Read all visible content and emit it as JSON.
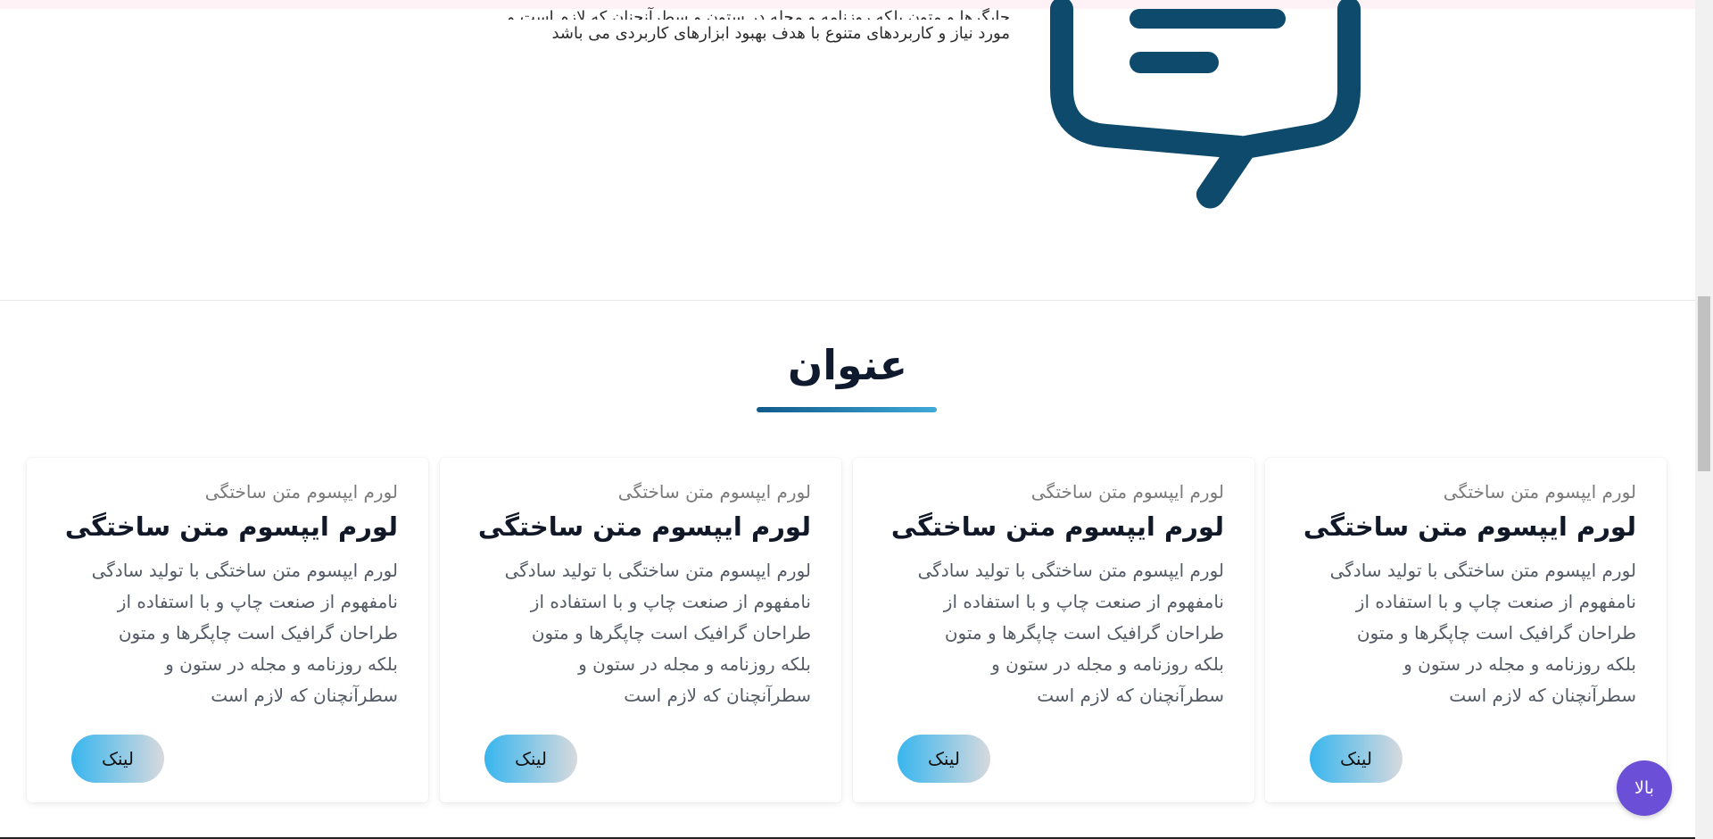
{
  "hero": {
    "text_cut": "چاپگرها و متون بلکه روزنامه و مجله در ستون و سطرآنچنان که لازم است و برای شرایط فعلی تکنولوژی",
    "text_line": "مورد نیاز و کاربردهای متنوع با هدف بهبود ابزارهای کاربردی می باشد"
  },
  "section": {
    "title": "عنوان"
  },
  "cards": [
    {
      "subtitle": "لورم ایپسوم متن ساختگی",
      "title": "لورم ایپسوم متن ساختگی",
      "body": "لورم ایپسوم متن ساختگی با تولید سادگی نامفهوم از صنعت چاپ و با استفاده از طراحان گرافیک است چاپگرها و متون بلکه روزنامه و مجله در ستون و سطرآنچنان که لازم است",
      "button_label": "لینک"
    },
    {
      "subtitle": "لورم ایپسوم متن ساختگی",
      "title": "لورم ایپسوم متن ساختگی",
      "body": "لورم ایپسوم متن ساختگی با تولید سادگی نامفهوم از صنعت چاپ و با استفاده از طراحان گرافیک است چاپگرها و متون بلکه روزنامه و مجله در ستون و سطرآنچنان که لازم است",
      "button_label": "لینک"
    },
    {
      "subtitle": "لورم ایپسوم متن ساختگی",
      "title": "لورم ایپسوم متن ساختگی",
      "body": "لورم ایپسوم متن ساختگی با تولید سادگی نامفهوم از صنعت چاپ و با استفاده از طراحان گرافیک است چاپگرها و متون بلکه روزنامه و مجله در ستون و سطرآنچنان که لازم است",
      "button_label": "لینک"
    },
    {
      "subtitle": "لورم ایپسوم متن ساختگی",
      "title": "لورم ایپسوم متن ساختگی",
      "body": "لورم ایپسوم متن ساختگی با تولید سادگی نامفهوم از صنعت چاپ و با استفاده از طراحان گرافیک است چاپگرها و متون بلکه روزنامه و مجله در ستون و سطرآنچنان که لازم است",
      "button_label": "لینک"
    }
  ],
  "scroll_top": {
    "label": "بالا"
  },
  "colors": {
    "bubble_icon": "#0d4a6b",
    "accent_gradient_start": "#38b6ee",
    "scroll_top_bg": "#6b4fd6"
  },
  "icons": {
    "hero_illustration": "chat-bubble-icon"
  }
}
